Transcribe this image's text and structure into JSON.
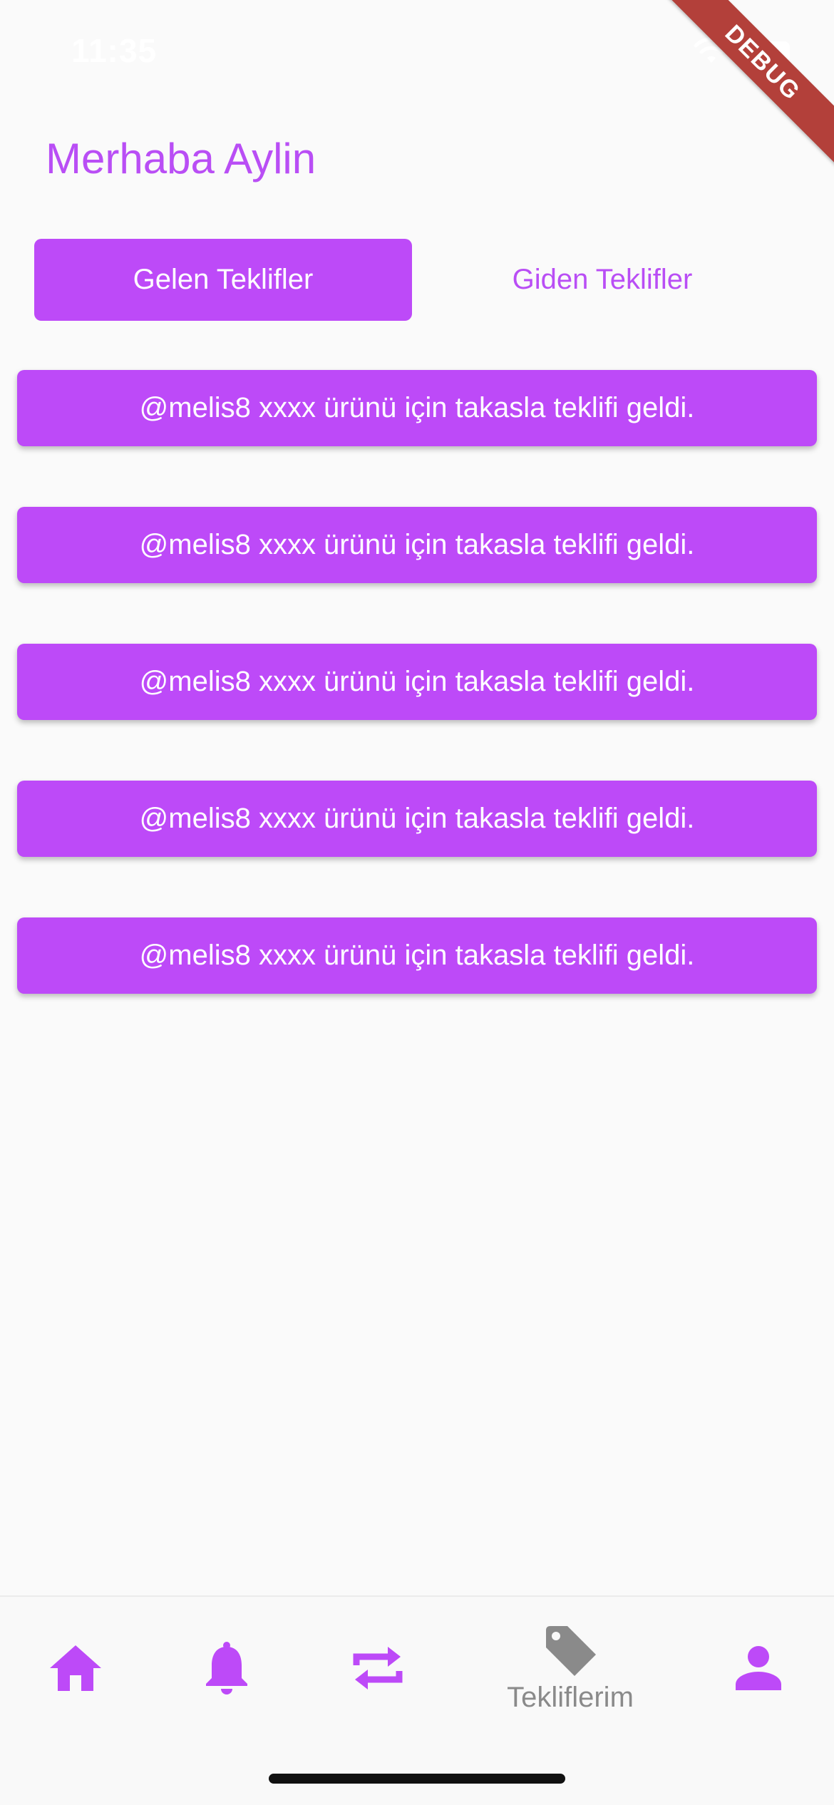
{
  "status_bar": {
    "time": "11:35"
  },
  "debug_banner": "DEBUG",
  "greeting": "Merhaba Aylin",
  "tabs": [
    {
      "label": "Gelen Teklifler",
      "active": true
    },
    {
      "label": "Giden Teklifler",
      "active": false
    }
  ],
  "offers": [
    {
      "text": "@melis8 xxxx ürünü için takasla teklifi geldi."
    },
    {
      "text": "@melis8 xxxx ürünü için takasla teklifi geldi."
    },
    {
      "text": "@melis8 xxxx ürünü için takasla teklifi geldi."
    },
    {
      "text": "@melis8 xxxx ürünü için takasla teklifi geldi."
    },
    {
      "text": "@melis8 xxxx ürünü için takasla teklifi geldi."
    }
  ],
  "bottom_nav": {
    "items": [
      {
        "icon": "home-icon",
        "label": ""
      },
      {
        "icon": "bell-icon",
        "label": ""
      },
      {
        "icon": "swap-icon",
        "label": ""
      },
      {
        "icon": "tag-icon",
        "label": "Tekliflerim",
        "selected": true
      },
      {
        "icon": "person-icon",
        "label": ""
      }
    ]
  },
  "colors": {
    "accent": "#bd4af8",
    "accent_text": "#b94ef5",
    "selected_nav": "#8a8a8a",
    "background": "#fafafa"
  }
}
